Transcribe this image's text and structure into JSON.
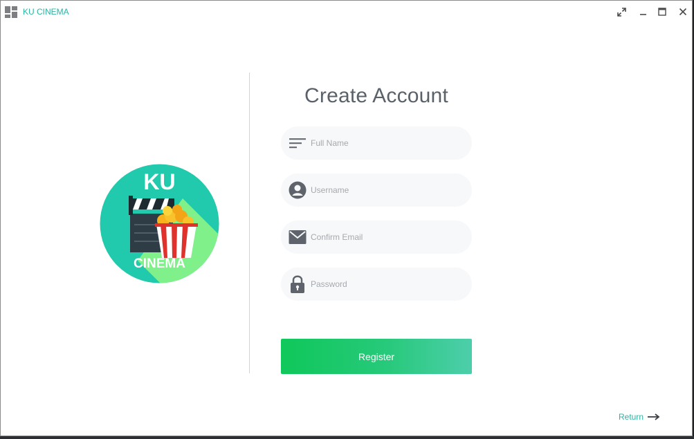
{
  "window": {
    "title": "KU CINEMA",
    "controls": [
      "expand-icon",
      "minimize-icon",
      "maximize-icon",
      "close-icon"
    ]
  },
  "logo": {
    "top_text": "KU",
    "bottom_text": "CINEMA"
  },
  "form": {
    "heading": "Create Account",
    "fields": [
      {
        "icon": "lines-icon",
        "placeholder": "Full Name"
      },
      {
        "icon": "user-icon",
        "placeholder": "Username"
      },
      {
        "icon": "mail-icon",
        "placeholder": "Confirm Email"
      },
      {
        "icon": "lock-icon",
        "placeholder": "Password"
      }
    ],
    "register_label": "Register"
  },
  "footer": {
    "return_label": "Return"
  },
  "colors": {
    "accent": "#2bb3a4",
    "heading": "#5b6169",
    "button_start": "#0fc85a",
    "button_end": "#4dceab",
    "field_bg": "#f7f8f9"
  }
}
